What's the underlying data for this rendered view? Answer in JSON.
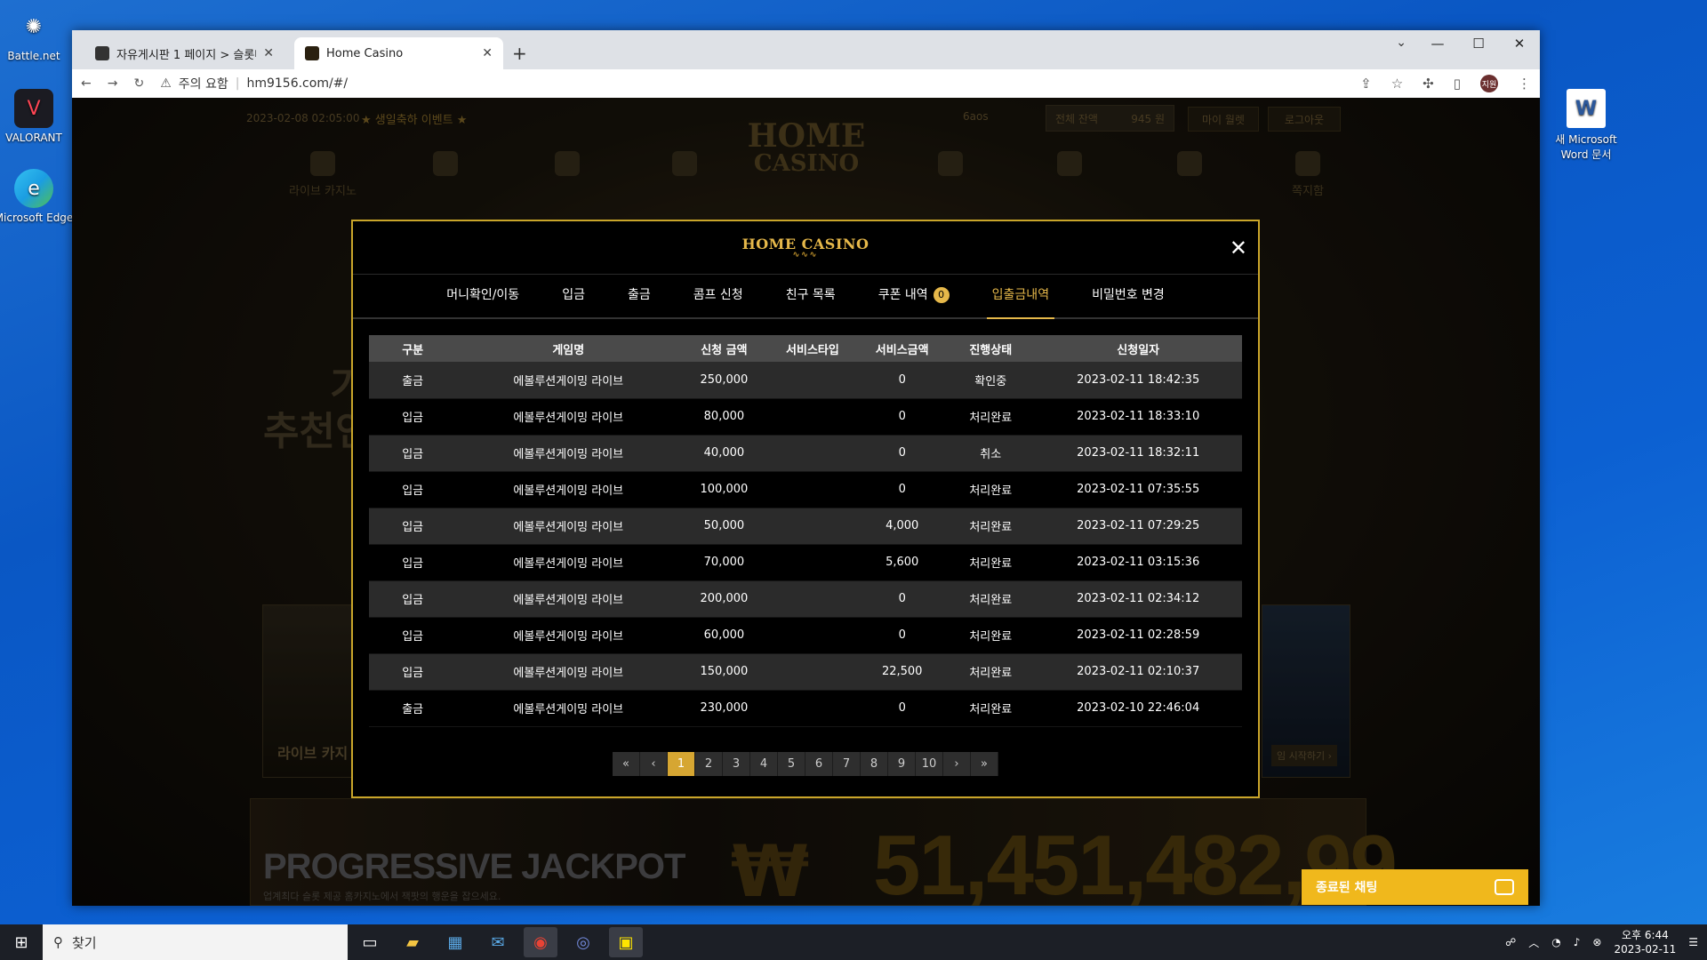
{
  "desktop": {
    "icons": [
      {
        "label": "Battle.net",
        "icon": "battlenet-icon"
      },
      {
        "label": "VALORANT",
        "icon": "valorant-icon"
      },
      {
        "label": "Microsoft Edge",
        "icon": "edge-icon"
      },
      {
        "label": "새 Microsoft Word 문서",
        "icon": "word-icon"
      }
    ]
  },
  "browser": {
    "tabs": [
      {
        "title": "자유게시판 1 페이지 > 슬롯나라",
        "active": false
      },
      {
        "title": "Home Casino",
        "active": true
      }
    ],
    "address": {
      "warning": "주의 요함",
      "url": "hm9156.com/#/"
    },
    "profile_initial": "지원"
  },
  "site": {
    "datetime": "2023-02-08 02:05:00",
    "event": "★ 생일축하 이벤트 ★",
    "username": "6aos",
    "balance_label": "전체 잔액",
    "balance_value": "945 원",
    "mypage": "마이 월렛",
    "logout": "로그아웃",
    "logo_top": "HOME",
    "logo_bottom": "CASINO",
    "nav_first": "라이브 카지노",
    "nav_last": "쪽지함",
    "hero_line1": "기",
    "hero_line2": "추천인",
    "live_card": "라이브 카지",
    "start_btn": "임 시작하기 ›",
    "jackpot_title": "PROGRESSIVE JACKPOT",
    "jackpot_sub": "업계최다 슬롯 제공 홈카지노에서 잭팟의 행운을 잡으세요.",
    "jackpot_currency": "₩",
    "jackpot_amount": "51,451,482,99"
  },
  "modal": {
    "logo": "HOME CASINO",
    "tabs": [
      {
        "label": "머니확인/이동"
      },
      {
        "label": "입금"
      },
      {
        "label": "출금"
      },
      {
        "label": "콤프 신청"
      },
      {
        "label": "친구 목록"
      },
      {
        "label": "쿠폰 내역",
        "badge": "0"
      },
      {
        "label": "입출금내역",
        "active": true
      },
      {
        "label": "비밀번호 변경"
      }
    ],
    "columns": [
      "구분",
      "게임명",
      "신청 금액",
      "서비스타입",
      "서비스금액",
      "진행상태",
      "신청일자"
    ],
    "rows": [
      [
        "출금",
        "에볼루션게이밍 라이브",
        "250,000",
        "",
        "0",
        "확인중",
        "2023-02-11 18:42:35"
      ],
      [
        "입금",
        "에볼루션게이밍 라이브",
        "80,000",
        "",
        "0",
        "처리완료",
        "2023-02-11 18:33:10"
      ],
      [
        "입금",
        "에볼루션게이밍 라이브",
        "40,000",
        "",
        "0",
        "취소",
        "2023-02-11 18:32:11"
      ],
      [
        "입금",
        "에볼루션게이밍 라이브",
        "100,000",
        "",
        "0",
        "처리완료",
        "2023-02-11 07:35:55"
      ],
      [
        "입금",
        "에볼루션게이밍 라이브",
        "50,000",
        "",
        "4,000",
        "처리완료",
        "2023-02-11 07:29:25"
      ],
      [
        "입금",
        "에볼루션게이밍 라이브",
        "70,000",
        "",
        "5,600",
        "처리완료",
        "2023-02-11 03:15:36"
      ],
      [
        "입금",
        "에볼루션게이밍 라이브",
        "200,000",
        "",
        "0",
        "처리완료",
        "2023-02-11 02:34:12"
      ],
      [
        "입금",
        "에볼루션게이밍 라이브",
        "60,000",
        "",
        "0",
        "처리완료",
        "2023-02-11 02:28:59"
      ],
      [
        "입금",
        "에볼루션게이밍 라이브",
        "150,000",
        "",
        "22,500",
        "처리완료",
        "2023-02-11 02:10:37"
      ],
      [
        "출금",
        "에볼루션게이밍 라이브",
        "230,000",
        "",
        "0",
        "처리완료",
        "2023-02-10 22:46:04"
      ]
    ],
    "pager": [
      "«",
      "‹",
      "1",
      "2",
      "3",
      "4",
      "5",
      "6",
      "7",
      "8",
      "9",
      "10",
      "›",
      "»"
    ],
    "current_page": "1"
  },
  "chat": {
    "label": "종료된 채팅"
  },
  "taskbar": {
    "search_placeholder": "찾기",
    "time": "오후 6:44",
    "date": "2023-02-11"
  },
  "colors": {
    "accent": "#e6b84a",
    "chat": "#f0b81c",
    "page_active": "#d6a632"
  }
}
